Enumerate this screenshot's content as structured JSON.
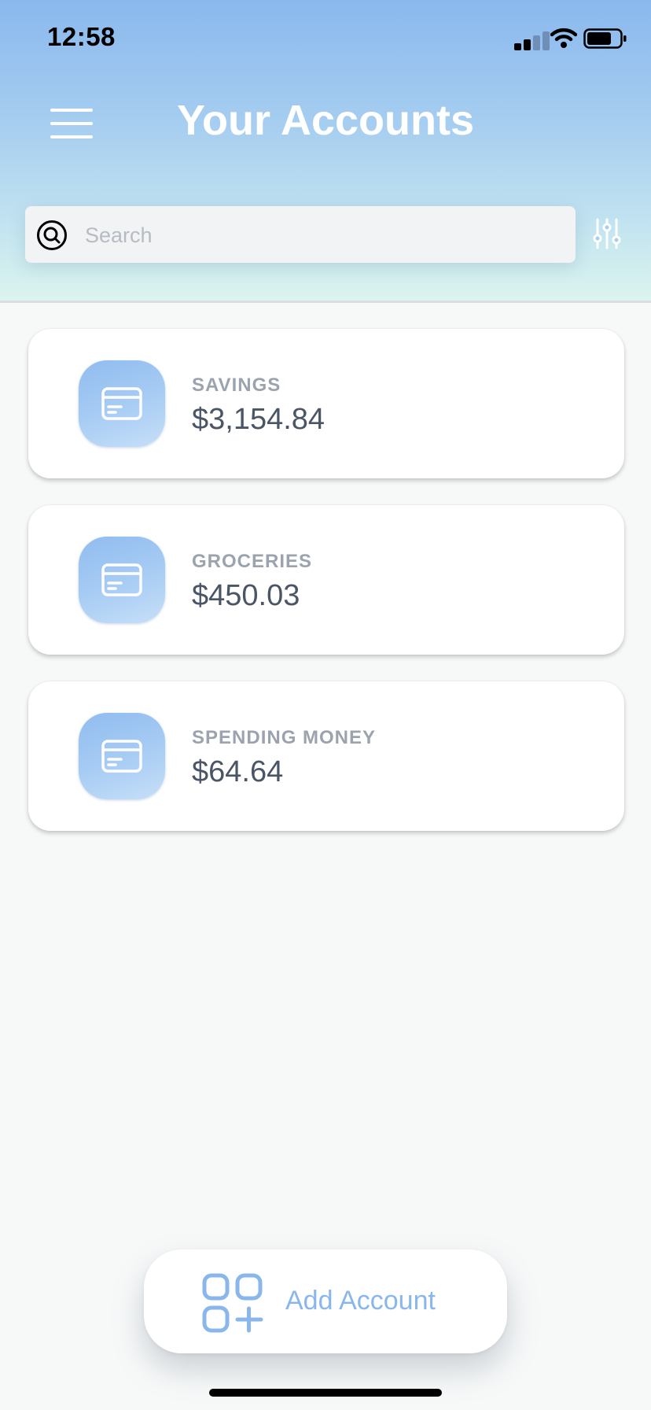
{
  "status_bar": {
    "time": "12:58"
  },
  "header": {
    "title": "Your Accounts"
  },
  "search": {
    "placeholder": "Search",
    "value": ""
  },
  "accounts": [
    {
      "name": "SAVINGS",
      "balance": "$3,154.84"
    },
    {
      "name": "GROCERIES",
      "balance": "$450.03"
    },
    {
      "name": "SPENDING MONEY",
      "balance": "$64.64"
    }
  ],
  "add_account": {
    "label": "Add Account"
  },
  "colors": {
    "accent": "#89b7ec",
    "header_gradient_top": "#8ab8ee",
    "header_gradient_bottom": "#dbf4ee",
    "balance_text": "#4a5566",
    "name_text": "#9aa3ae"
  },
  "icons": {
    "menu": "hamburger-menu-icon",
    "search": "search-icon",
    "filter": "sliders-filter-icon",
    "account": "credit-card-icon",
    "add": "grid-plus-icon"
  }
}
